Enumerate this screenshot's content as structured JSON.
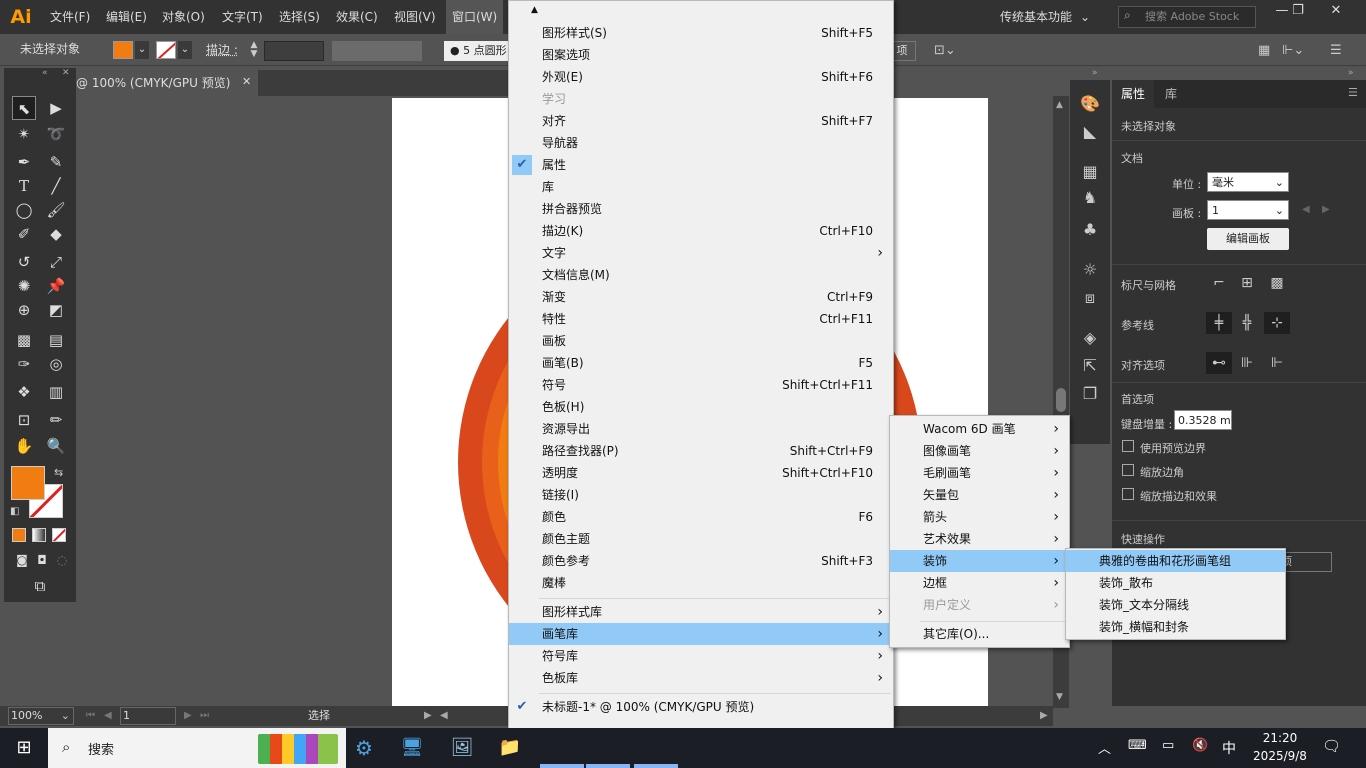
{
  "app": {
    "logo": "Ai"
  },
  "menubar": {
    "items": [
      "文件(F)",
      "编辑(E)",
      "对象(O)",
      "文字(T)",
      "选择(S)",
      "效果(C)",
      "视图(V)",
      "窗口(W)"
    ],
    "workspace": "传统基本功能",
    "search_placeholder": "搜索 Adobe Stock",
    "window_buttons": [
      "—",
      "❐",
      "✕"
    ]
  },
  "control_bar": {
    "selection_label": "未选择对象",
    "fill_color": "#f07c12",
    "stroke_label": "描边 :",
    "brush_size": "5 点圆形",
    "tail_btn": "项"
  },
  "document_tab": {
    "title": "@ 100% (CMYK/GPU 预览)",
    "close": "✕"
  },
  "status": {
    "zoom": "100%",
    "artboard": "1",
    "tool": "选择"
  },
  "properties_panel": {
    "tabs": [
      "属性",
      "库"
    ],
    "no_selection": "未选择对象",
    "document_header": "文档",
    "unit_label": "单位 :",
    "unit_value": "毫米",
    "artboard_label": "画板 :",
    "artboard_value": "1",
    "edit_artboard_btn": "编辑画板",
    "rulers_grids_label": "标尺与网格",
    "guides_label": "参考线",
    "snap_label": "对齐选项",
    "prefs_header": "首选项",
    "keyboard_inc_label": "键盘增量 :",
    "keyboard_inc_value": "0.3528 mm",
    "check_preview_bounds": "使用预览边界",
    "check_scale_corners": "缩放边角",
    "check_scale_strokes": "缩放描边和效果",
    "quick_actions_header": "快速操作",
    "quick_action_btn_tail": "项"
  },
  "window_menu": {
    "items": [
      {
        "label": "图形样式(S)",
        "shortcut": "Shift+F5"
      },
      {
        "label": "图案选项",
        "shortcut": ""
      },
      {
        "label": "外观(E)",
        "shortcut": "Shift+F6"
      },
      {
        "label": "学习",
        "shortcut": "",
        "disabled": true
      },
      {
        "label": "对齐",
        "shortcut": "Shift+F7"
      },
      {
        "label": "导航器",
        "shortcut": ""
      },
      {
        "label": "属性",
        "shortcut": "",
        "checked": true
      },
      {
        "label": "库",
        "shortcut": ""
      },
      {
        "label": "拼合器预览",
        "shortcut": ""
      },
      {
        "label": "描边(K)",
        "shortcut": "Ctrl+F10"
      },
      {
        "label": "文字",
        "shortcut": "",
        "submenu": true
      },
      {
        "label": "文档信息(M)",
        "shortcut": ""
      },
      {
        "label": "渐变",
        "shortcut": "Ctrl+F9"
      },
      {
        "label": "特性",
        "shortcut": "Ctrl+F11"
      },
      {
        "label": "画板",
        "shortcut": ""
      },
      {
        "label": "画笔(B)",
        "shortcut": "F5"
      },
      {
        "label": "符号",
        "shortcut": "Shift+Ctrl+F11"
      },
      {
        "label": "色板(H)",
        "shortcut": ""
      },
      {
        "label": "资源导出",
        "shortcut": ""
      },
      {
        "label": "路径查找器(P)",
        "shortcut": "Shift+Ctrl+F9"
      },
      {
        "label": "透明度",
        "shortcut": "Shift+Ctrl+F10"
      },
      {
        "label": "链接(I)",
        "shortcut": ""
      },
      {
        "label": "颜色",
        "shortcut": "F6"
      },
      {
        "label": "颜色主题",
        "shortcut": ""
      },
      {
        "label": "颜色参考",
        "shortcut": "Shift+F3"
      },
      {
        "label": "魔棒",
        "shortcut": ""
      }
    ],
    "libraries": [
      {
        "label": "图形样式库",
        "submenu": true
      },
      {
        "label": "画笔库",
        "submenu": true,
        "highlighted": true
      },
      {
        "label": "符号库",
        "submenu": true
      },
      {
        "label": "色板库",
        "submenu": true
      }
    ],
    "open_document": "未标题-1* @ 100% (CMYK/GPU 预览)",
    "scroll_up": "▲",
    "scroll_down": "▼"
  },
  "brush_library_menu": {
    "items": [
      {
        "label": "Wacom 6D 画笔",
        "submenu": true
      },
      {
        "label": "图像画笔",
        "submenu": true
      },
      {
        "label": "毛刷画笔",
        "submenu": true
      },
      {
        "label": "矢量包",
        "submenu": true
      },
      {
        "label": "箭头",
        "submenu": true
      },
      {
        "label": "艺术效果",
        "submenu": true
      },
      {
        "label": "装饰",
        "submenu": true,
        "highlighted": true
      },
      {
        "label": "边框",
        "submenu": true
      },
      {
        "label": "用户定义",
        "submenu": true,
        "disabled": true
      }
    ],
    "other_library": "其它库(O)..."
  },
  "decorative_menu": {
    "items": [
      {
        "label": "典雅的卷曲和花形画笔组",
        "highlighted": true
      },
      {
        "label": "装饰_散布"
      },
      {
        "label": "装饰_文本分隔线"
      },
      {
        "label": "装饰_横幅和封条"
      }
    ]
  },
  "taskbar": {
    "search_label": "搜索",
    "time": "21:20",
    "date": "2025/9/8",
    "ime": "中"
  },
  "colors": {
    "fill": "#f07c12",
    "circle_outer": "#d9481c",
    "circle_mid": "#e8601a",
    "circle_inner": "#f07c12",
    "menu_highlight": "#91c9f7"
  }
}
